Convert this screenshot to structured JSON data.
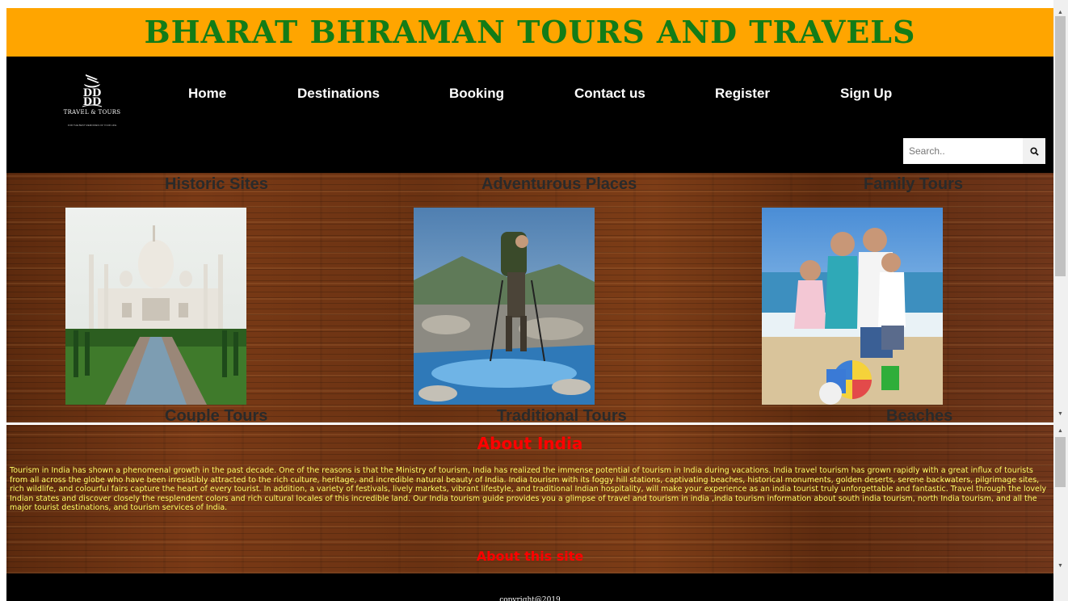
{
  "header": {
    "title": "BHARAT BHRAMAN TOURS AND TRAVELS"
  },
  "logo": {
    "text": "TRAVEL & TOURS",
    "subtext": "FOR THE BEST MEMORIES OF YOUR LIFE"
  },
  "nav": {
    "items": [
      {
        "label": "Home"
      },
      {
        "label": "Destinations"
      },
      {
        "label": "Booking"
      },
      {
        "label": "Contact us"
      },
      {
        "label": "Register"
      },
      {
        "label": "Sign Up"
      }
    ]
  },
  "search": {
    "placeholder": "Search..",
    "icon": "search-icon"
  },
  "gallery": {
    "categories": [
      {
        "label": "Historic Sites"
      },
      {
        "label": "Adventurous Places"
      },
      {
        "label": "Family Tours"
      },
      {
        "label": "Couple Tours"
      },
      {
        "label": "Traditional Tours"
      },
      {
        "label": "Beaches"
      }
    ],
    "photos": [
      {
        "subject": "Taj Mahal"
      },
      {
        "subject": "Hiker crossing a mountain stream"
      },
      {
        "subject": "Family on a beach"
      }
    ]
  },
  "about": {
    "heading": "About India",
    "text": "Tourism in India has shown a phenomenal growth in the past decade. One of the reasons is that the Ministry of tourism, India has realized the immense potential of tourism in India during vacations. India travel tourism has grown rapidly with a great influx of tourists from all across the globe who have been irresistibly attracted to the rich culture, heritage, and incredible natural beauty of India. India tourism with its foggy hill stations, captivating beaches, historical monuments, golden deserts, serene backwaters, pilgrimage sites, rich wildlife, and colourful fairs capture the heart of every tourist. In addition, a variety of festivals, lively markets, vibrant lifestyle, and traditional Indian hospitality, will make your experience as an india tourist truly unforgettable and fantastic. Travel through the lovely Indian states and discover closely the resplendent colors and rich cultural locales of this incredible land. Our India tourism guide provides you a glimpse of travel and tourism in india ,india tourism information about south india tourism, north India tourism, and all the major tourist destinations, and tourism services of India.",
    "subheading": "About this site"
  },
  "footer": {
    "copyright": "copyright@2019"
  },
  "colors": {
    "header_bg": "#ffa500",
    "title": "#137c17",
    "nav_bg": "#000000",
    "about_heading": "#ff0000",
    "about_text": "#ffff66"
  }
}
